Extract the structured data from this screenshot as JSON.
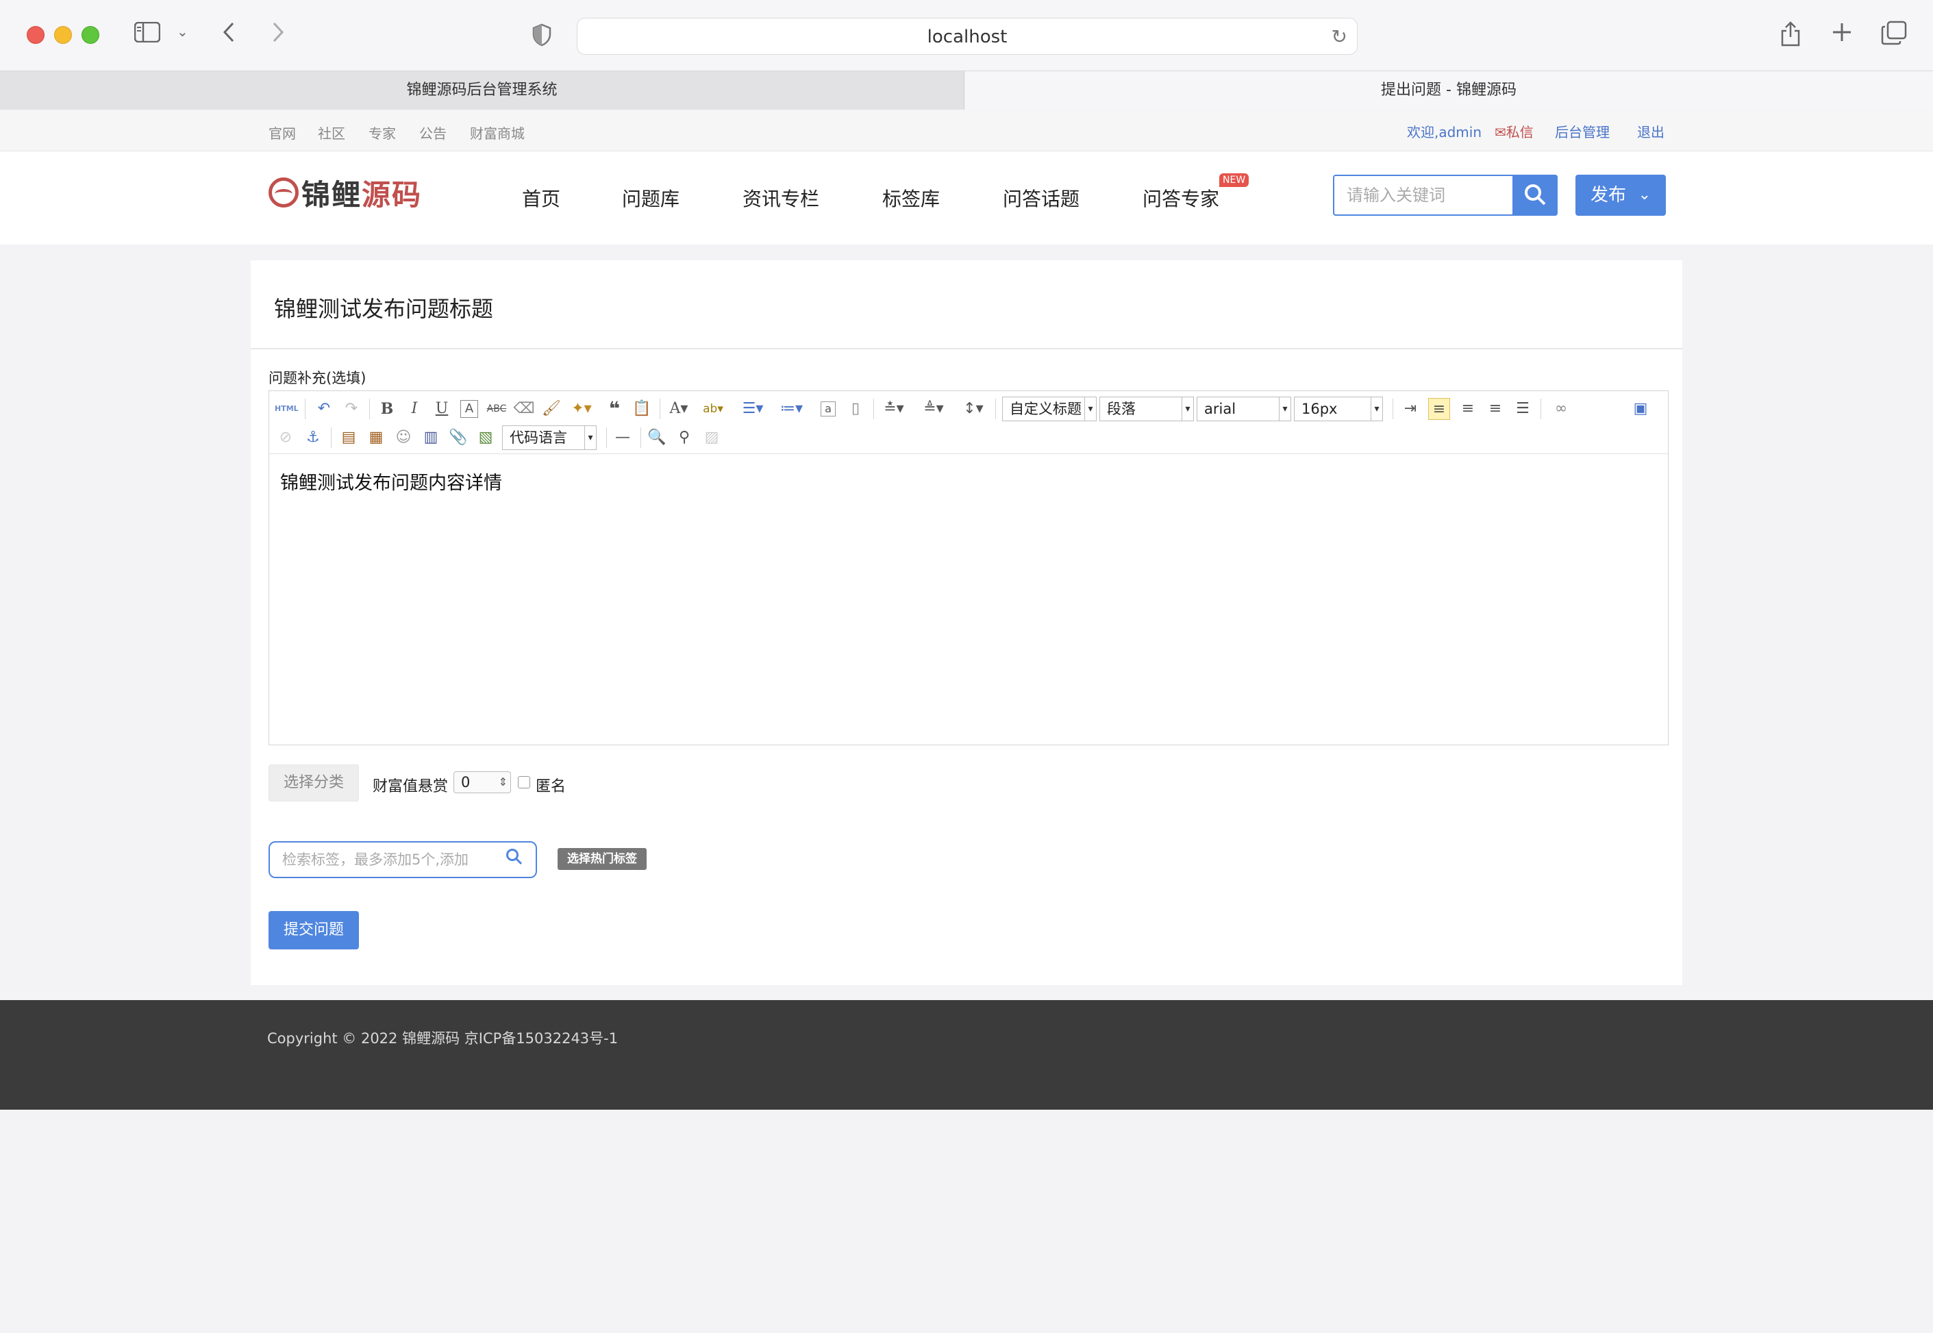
{
  "browser": {
    "url": "localhost",
    "tabs": [
      {
        "label": "锦鲤源码后台管理系统"
      },
      {
        "label": "提出问题 - 锦鲤源码"
      }
    ]
  },
  "topnav": {
    "left": [
      "官网",
      "社区",
      "专家",
      "公告",
      "财富商城"
    ],
    "welcome": "欢迎,admin",
    "messages": "私信",
    "admin": "后台管理",
    "logout": "退出"
  },
  "header": {
    "logo_part1": "锦鲤",
    "logo_part2": "源码",
    "nav": [
      "首页",
      "问题库",
      "资讯专栏",
      "标签库",
      "问答话题",
      "问答专家"
    ],
    "new_badge": "NEW",
    "search_placeholder": "请输入关键词",
    "publish_label": "发布"
  },
  "form": {
    "title": "锦鲤测试发布问题标题",
    "supplement_label": "问题补充(选填)",
    "editor": {
      "html_label": "HTML",
      "custom_heading": "自定义标题",
      "paragraph": "段落",
      "font": "arial",
      "size": "16px",
      "code_language": "代码语言",
      "content": "锦鲤测试发布问题内容详情"
    },
    "category_button": "选择分类",
    "reward_label": "财富值悬赏",
    "reward_value": "0",
    "anonymous_label": "匿名",
    "tag_placeholder": "检索标签，最多添加5个,添加",
    "hot_tags_button": "选择热门标签",
    "submit_button": "提交问题"
  },
  "footer": {
    "copyright": "Copyright © 2022 锦鲤源码 京ICP备15032243号-1"
  },
  "colors": {
    "accent": "#4f86e0",
    "brand_red": "#c0504d",
    "footer_bg": "#3c3b3c"
  }
}
